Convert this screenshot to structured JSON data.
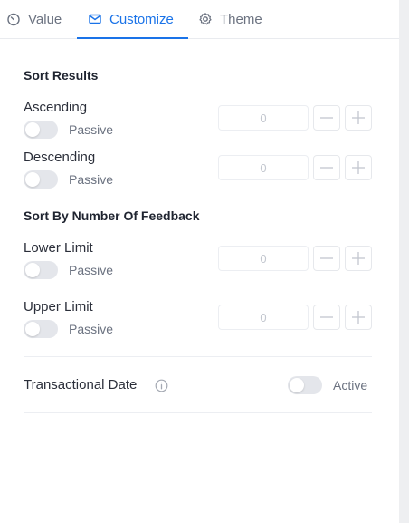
{
  "tabs": [
    {
      "label": "Value",
      "icon": "timer-icon"
    },
    {
      "label": "Customize",
      "icon": "mail-icon",
      "active": true
    },
    {
      "label": "Theme",
      "icon": "gear-icon"
    }
  ],
  "accent_color": "#1a73e8",
  "sort_results": {
    "title": "Sort Results",
    "ascending": {
      "label": "Ascending",
      "toggle_label": "Passive",
      "value": "0"
    },
    "descending": {
      "label": "Descending",
      "toggle_label": "Passive",
      "value": "0"
    }
  },
  "sort_by_feedback": {
    "title": "Sort By Number Of Feedback",
    "lower_limit": {
      "label": "Lower Limit",
      "toggle_label": "Passive",
      "value": "0"
    },
    "upper_limit": {
      "label": "Upper Limit",
      "toggle_label": "Passive",
      "value": "0"
    }
  },
  "transactional_date": {
    "label": "Transactional Date",
    "toggle_label": "Active",
    "info_icon": "info-icon"
  }
}
